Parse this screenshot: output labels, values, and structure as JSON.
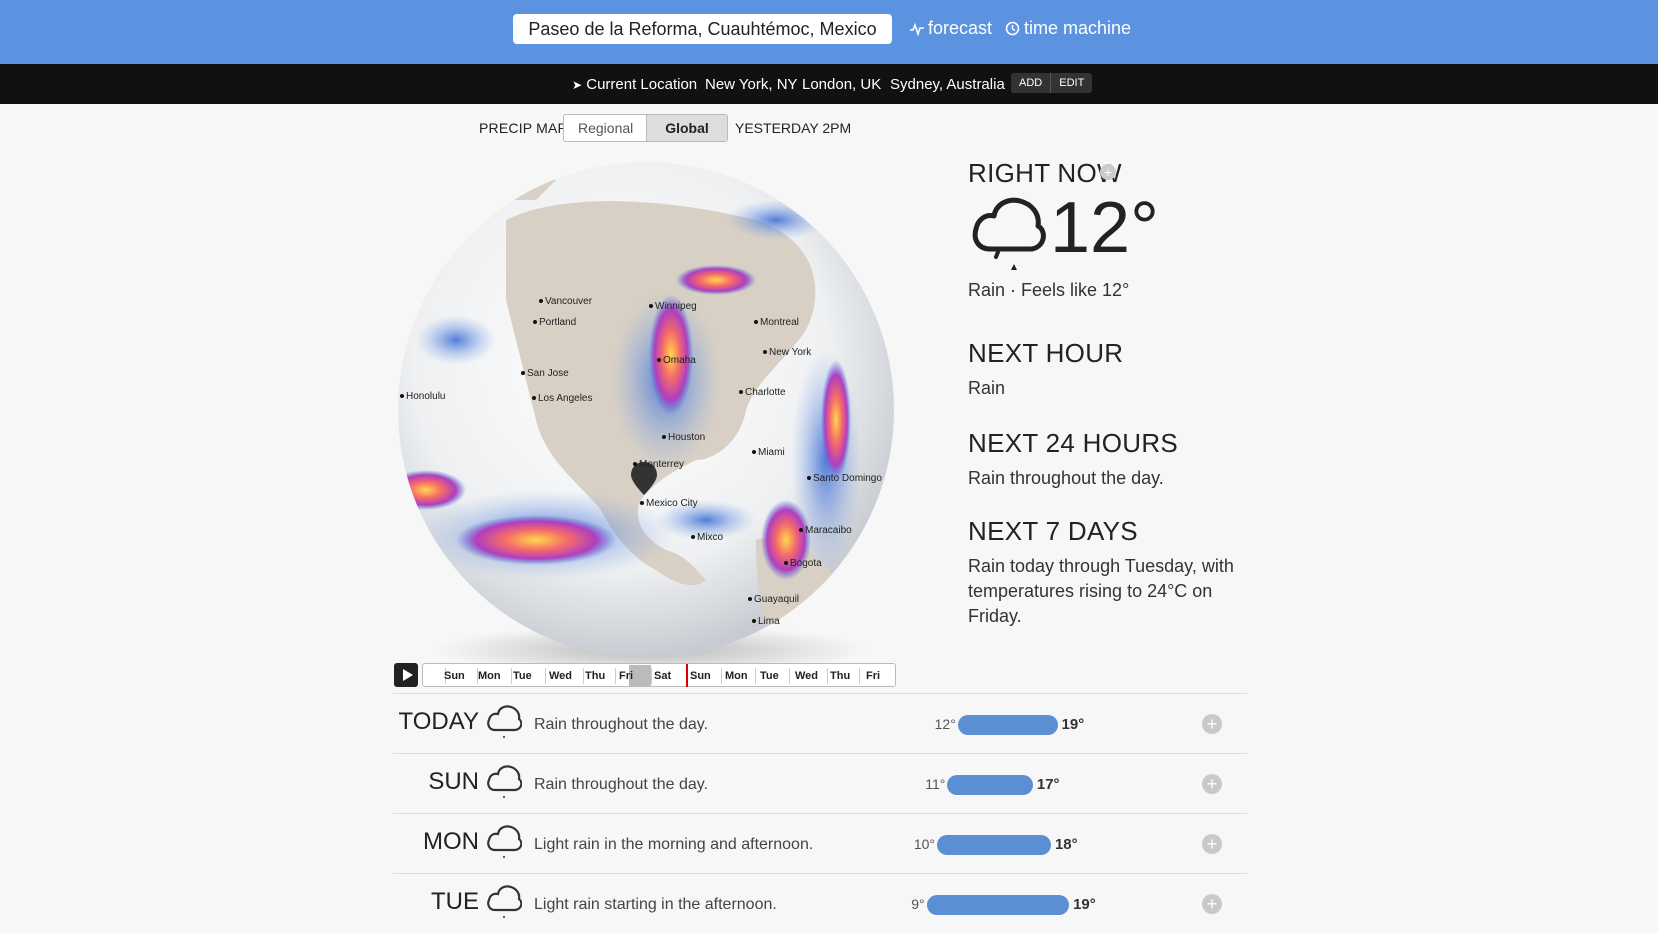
{
  "search": {
    "value": "Paseo de la Reforma, Cuauhtémoc, Mexico"
  },
  "header": {
    "forecast_label": "forecast",
    "time_machine_label": "time machine"
  },
  "nav": {
    "items": [
      "Current Location",
      "New York, NY",
      "London, UK",
      "Sydney, Australia"
    ],
    "add_label": "ADD",
    "edit_label": "EDIT"
  },
  "precip": {
    "label": "PRECIP MAP",
    "regional": "Regional",
    "global": "Global",
    "selected": "Global",
    "time": "YESTERDAY 2PM"
  },
  "map": {
    "cities": [
      "Vancouver",
      "Portland",
      "Winnipeg",
      "Montreal",
      "New York",
      "Omaha",
      "San Jose",
      "Los Angeles",
      "Honolulu",
      "Charlotte",
      "Houston",
      "Miami",
      "Monterrey",
      "Mexico City",
      "Santo Domingo",
      "Maracaibo",
      "Mixco",
      "Bogota",
      "Guayaquil",
      "Lima"
    ]
  },
  "timeline": {
    "days": [
      "Sun",
      "Mon",
      "Tue",
      "Wed",
      "Thu",
      "Fri",
      "Sat",
      "Sun",
      "Mon",
      "Tue",
      "Wed",
      "Thu",
      "Fri"
    ]
  },
  "right_now": {
    "title": "RIGHT NOW",
    "temp": "12°",
    "summary": "Rain · Feels like 12°"
  },
  "next_hour": {
    "title": "NEXT HOUR",
    "text": "Rain"
  },
  "next_24": {
    "title": "NEXT 24 HOURS",
    "text": "Rain throughout the day."
  },
  "next_7": {
    "title": "NEXT 7 DAYS",
    "text": "Rain today through Tuesday, with temperatures rising to 24°C on Friday."
  },
  "daily": [
    {
      "day": "TODAY",
      "summary": "Rain throughout the day.",
      "low": "12°",
      "high": "19°",
      "low_val": 12,
      "high_val": 19
    },
    {
      "day": "SUN",
      "summary": "Rain throughout the day.",
      "low": "11°",
      "high": "17°",
      "low_val": 11,
      "high_val": 17
    },
    {
      "day": "MON",
      "summary": "Light rain in the morning and afternoon.",
      "low": "10°",
      "high": "18°",
      "low_val": 10,
      "high_val": 18
    },
    {
      "day": "TUE",
      "summary": "Light rain starting in the afternoon.",
      "low": "9°",
      "high": "19°",
      "low_val": 9,
      "high_val": 19
    }
  ],
  "colors": {
    "accent": "#5b93e0",
    "bar": "#5b8fd4",
    "nav": "#111111"
  }
}
